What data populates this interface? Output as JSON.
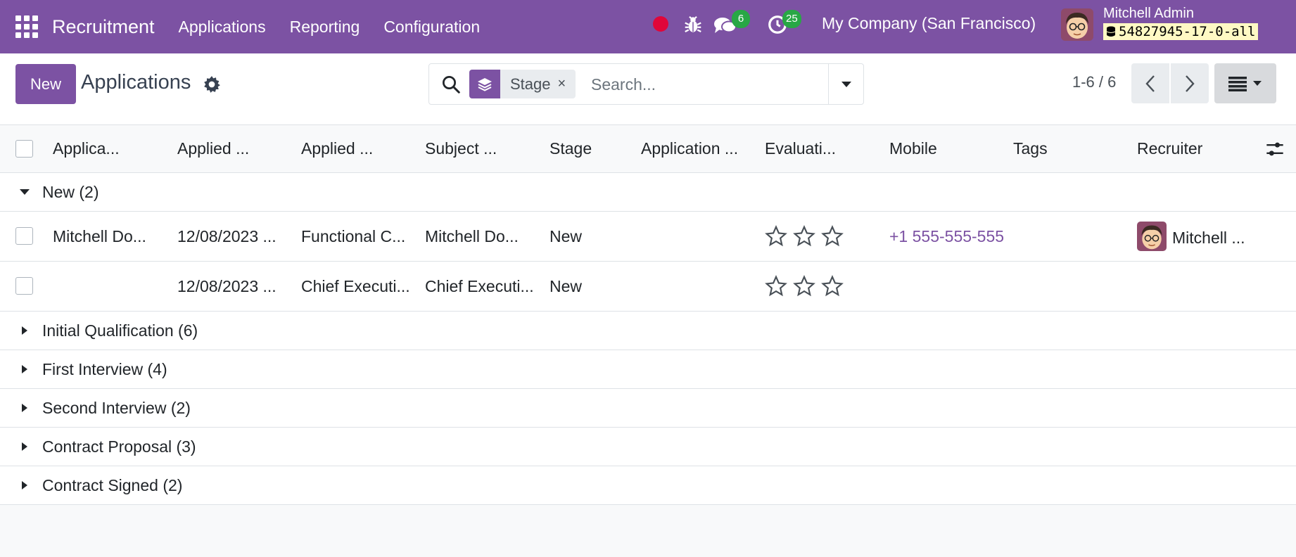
{
  "navbar": {
    "app_name": "Recruitment",
    "menu": [
      "Applications",
      "Reporting",
      "Configuration"
    ],
    "messages_count": "6",
    "activities_count": "25",
    "company": "My Company (San Francisco)",
    "user_name": "Mitchell Admin",
    "database": "54827945-17-0-all",
    "brand_color": "#7c52a3"
  },
  "control": {
    "new_label": "New",
    "title": "Applications",
    "facet_label": "Stage",
    "facet_remove": "×",
    "search_placeholder": "Search...",
    "pager": "1-6 / 6"
  },
  "table": {
    "columns": [
      "Applica...",
      "Applied ...",
      "Applied ...",
      "Subject ...",
      "Stage",
      "Application ...",
      "Evaluati...",
      "Mobile",
      "Tags",
      "Recruiter"
    ],
    "groups": [
      {
        "label": "New (2)",
        "expanded": true,
        "rows": [
          {
            "applicant": "Mitchell Do...",
            "applied_on": "12/08/2023 ...",
            "job": "Functional C...",
            "subject": "Mitchell Do...",
            "stage": "New",
            "application_status": "",
            "evaluation": 0,
            "mobile": "+1 555-555-555",
            "tags": "",
            "recruiter": "Mitchell ..."
          },
          {
            "applicant": "",
            "applied_on": "12/08/2023 ...",
            "job": "Chief Executi...",
            "subject": "Chief Executi...",
            "stage": "New",
            "application_status": "",
            "evaluation": 0,
            "mobile": "",
            "tags": "",
            "recruiter": ""
          }
        ]
      },
      {
        "label": "Initial Qualification (6)",
        "expanded": false
      },
      {
        "label": "First Interview (4)",
        "expanded": false
      },
      {
        "label": "Second Interview (2)",
        "expanded": false
      },
      {
        "label": "Contract Proposal (3)",
        "expanded": false
      },
      {
        "label": "Contract Signed (2)",
        "expanded": false
      }
    ]
  }
}
